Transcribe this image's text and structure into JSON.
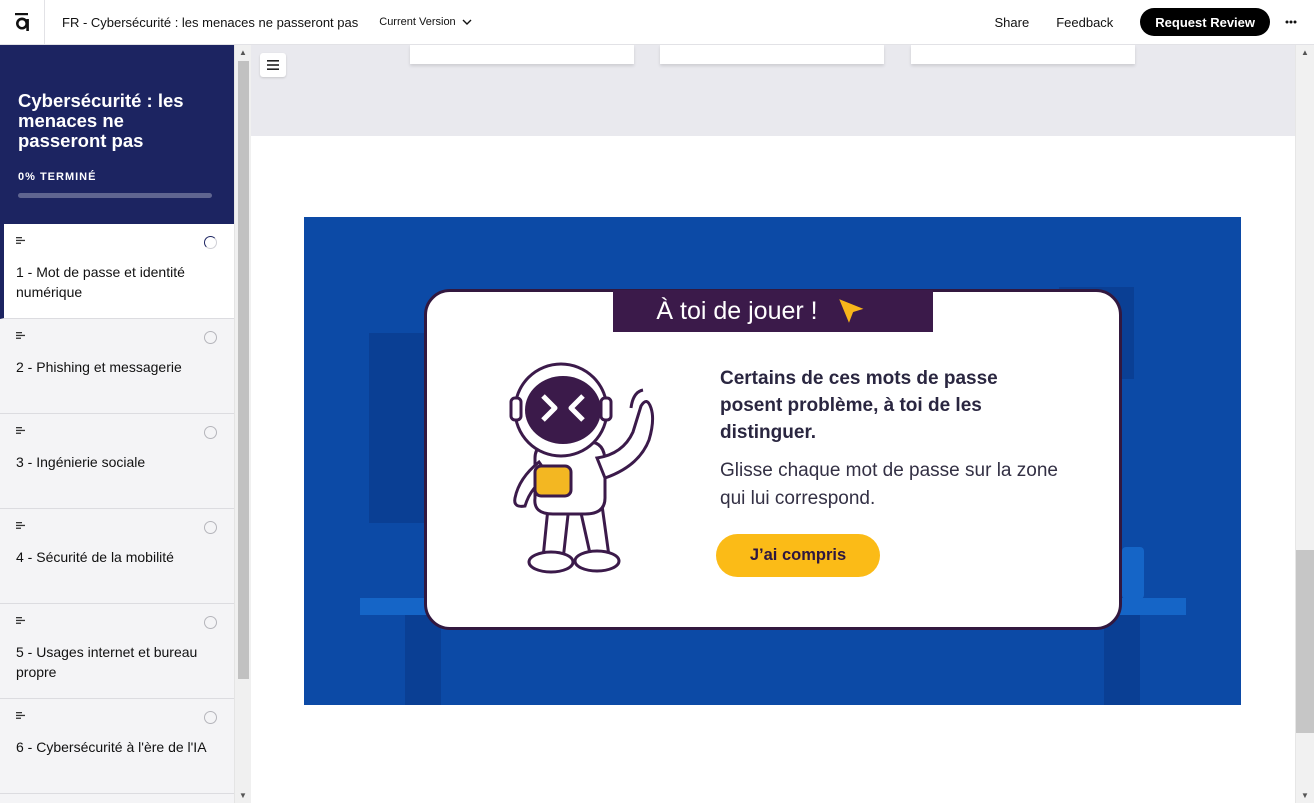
{
  "header": {
    "logo_icon": "articulate-a-logo",
    "document_title": "FR - Cybersécurité : les menaces ne passeront pas",
    "version_label": "Current Version",
    "share_label": "Share",
    "feedback_label": "Feedback",
    "review_label": "Request Review",
    "more_icon": "ellipsis-icon"
  },
  "sidebar": {
    "course_title": "Cybersécurité : les menaces ne passeront pas",
    "progress_label": "0% TERMINÉ",
    "progress_fraction": 0.0,
    "lessons": [
      {
        "label": "1 - Mot de passe et identité numérique",
        "status": "in-progress"
      },
      {
        "label": "2 - Phishing et messagerie",
        "status": "not-started"
      },
      {
        "label": "3 - Ingénierie sociale",
        "status": "not-started"
      },
      {
        "label": "4 - Sécurité de la mobilité",
        "status": "not-started"
      },
      {
        "label": "5 - Usages internet et bureau propre",
        "status": "not-started"
      },
      {
        "label": "6 - Cybersécurité à l'ère de l'IA",
        "status": "not-started"
      }
    ]
  },
  "main": {
    "modal": {
      "banner_title": "À toi de jouer !",
      "heading": "Certains de ces mots de passe posent problème, à toi de les distinguer.",
      "body": "Glisse chaque mot de passe sur la zone qui lui correspond.",
      "button_label": "J’ai compris"
    }
  },
  "colors": {
    "sidebar_header": "#1c2461",
    "scene_background": "#0c4aa6",
    "banner": "#3b1a4a",
    "button": "#fbbb17"
  }
}
